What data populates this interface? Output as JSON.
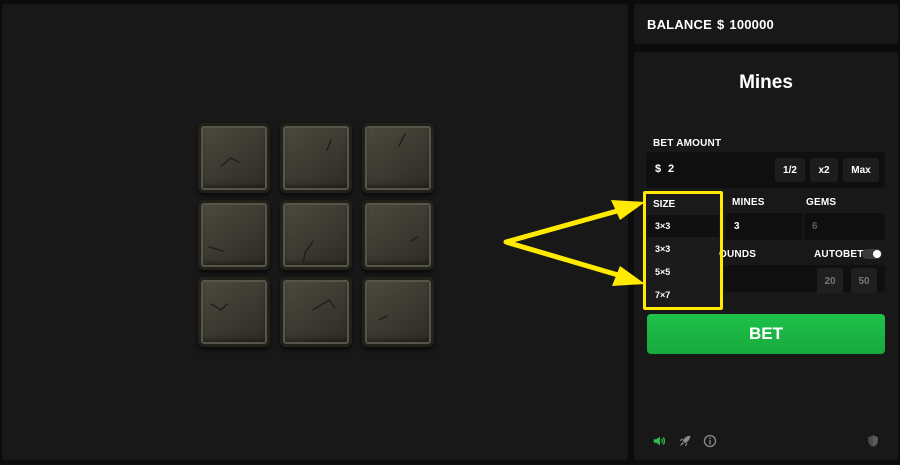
{
  "balance": {
    "label": "BALANCE",
    "currency": "$",
    "amount": "100000"
  },
  "game": {
    "title": "Mines",
    "tile_count": 9
  },
  "bet": {
    "label": "BET AMOUNT",
    "currency": "$",
    "amount": "2",
    "half_label": "1/2",
    "double_label": "x2",
    "max_label": "Max"
  },
  "size": {
    "label": "SIZE",
    "value": "3×3",
    "options": [
      "3×3",
      "5×5",
      "7×7"
    ]
  },
  "mines": {
    "label": "MINES",
    "value": "3"
  },
  "gems": {
    "label": "GEMS",
    "value": "6"
  },
  "rounds": {
    "label_visible": "OUNDS"
  },
  "autobet": {
    "label": "AUTOBET",
    "enabled": false
  },
  "round_presets": [
    "20",
    "50"
  ],
  "bet_button": {
    "label": "BET"
  },
  "footer_icons": [
    "sound-icon",
    "rocket-icon",
    "info-icon",
    "shield-icon"
  ],
  "colors": {
    "accent_green": "#1ec24b",
    "annotation_yellow": "#ffea00",
    "sound_icon": "#2ec04f"
  }
}
